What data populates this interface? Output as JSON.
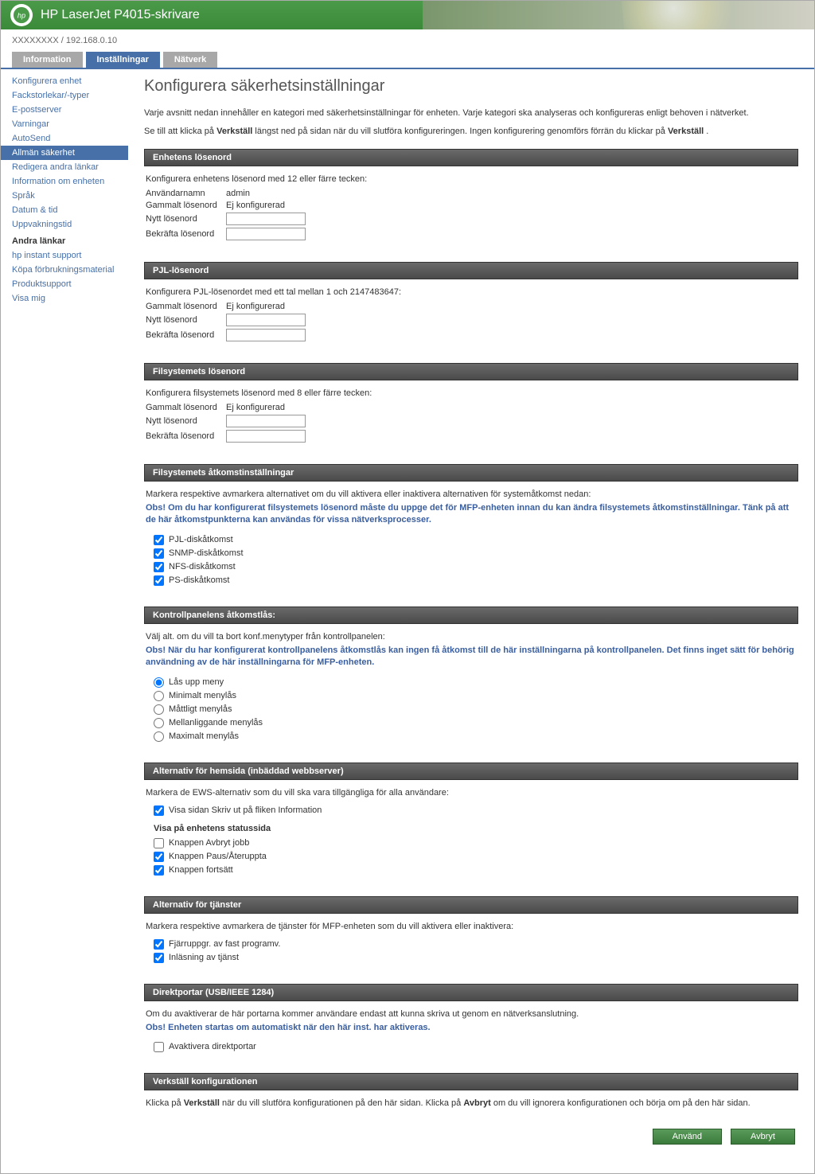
{
  "header": {
    "title": "HP LaserJet P4015-skrivare",
    "subheader": "XXXXXXXX / 192.168.0.10"
  },
  "tabs": {
    "t0": "Information",
    "t1": "Inställningar",
    "t2": "Nätverk"
  },
  "sidebar": {
    "items": [
      "Konfigurera enhet",
      "Fackstorlekar/-typer",
      "E-postserver",
      "Varningar",
      "AutoSend",
      "Allmän säkerhet",
      "Redigera andra länkar",
      "Information om enheten",
      "Språk",
      "Datum & tid",
      "Uppvakningstid"
    ],
    "links_title": "Andra länkar",
    "links": [
      "hp instant support",
      "Köpa förbrukningsmaterial",
      "Produktsupport",
      "Visa mig"
    ]
  },
  "page": {
    "title": "Konfigurera säkerhetsinställningar",
    "intro1": "Varje avsnitt nedan innehåller en kategori med säkerhetsinställningar för enheten. Varje kategori ska analyseras och konfigureras enligt behoven i nätverket.",
    "intro2a": "Se till att klicka på ",
    "intro2b": "Verkställ",
    "intro2c": " längst ned på sidan när du vill slutföra konfigureringen. Ingen konfigurering genomförs förrän du klickar på ",
    "intro2d": "Verkställ",
    "intro2e": " ."
  },
  "sec_device_pw": {
    "title": "Enhetens lösenord",
    "desc": "Konfigurera enhetens lösenord med 12 eller färre tecken:",
    "user_label": "Användarnamn",
    "user_value": "admin",
    "old_label": "Gammalt lösenord",
    "old_value": "Ej konfigurerad",
    "new_label": "Nytt lösenord",
    "confirm_label": "Bekräfta lösenord"
  },
  "sec_pjl": {
    "title": "PJL-lösenord",
    "desc": "Konfigurera PJL-lösenordet med ett tal mellan 1 och 2147483647:",
    "old_label": "Gammalt lösenord",
    "old_value": "Ej konfigurerad",
    "new_label": "Nytt lösenord",
    "confirm_label": "Bekräfta lösenord"
  },
  "sec_fs": {
    "title": "Filsystemets lösenord",
    "desc": "Konfigurera filsystemets lösenord med 8 eller färre tecken:",
    "old_label": "Gammalt lösenord",
    "old_value": "Ej konfigurerad",
    "new_label": "Nytt lösenord",
    "confirm_label": "Bekräfta lösenord"
  },
  "sec_fsaccess": {
    "title": "Filsystemets åtkomstinställningar",
    "desc": "Markera respektive avmarkera alternativet om du vill aktivera eller inaktivera alternativen för systemåtkomst nedan:",
    "note": "Obs! Om du har konfigurerat filsystemets lösenord måste du uppge det för MFP-enheten innan du kan ändra filsystemets åtkomstinställningar. Tänk på att de här åtkomstpunkterna kan användas för vissa nätverksprocesser.",
    "opts": [
      "PJL-diskåtkomst",
      "SNMP-diskåtkomst",
      "NFS-diskåtkomst",
      "PS-diskåtkomst"
    ]
  },
  "sec_cplock": {
    "title": "Kontrollpanelens åtkomstlås:",
    "desc": "Välj alt. om du vill ta bort konf.menytyper från kontrollpanelen:",
    "note": "Obs! När du har konfigurerat kontrollpanelens åtkomstlås kan ingen få åtkomst till de här inställningarna på kontrollpanelen. Det finns inget sätt för behörig användning av de här inställningarna för MFP-enheten.",
    "opts": [
      "Lås upp meny",
      "Minimalt menylås",
      "Måttligt menylås",
      "Mellanliggande menylås",
      "Maximalt menylås"
    ]
  },
  "sec_ews": {
    "title": "Alternativ för hemsida (inbäddad webbserver)",
    "desc": "Markera de EWS-alternativ som du vill ska vara tillgängliga för alla användare:",
    "opt_print": "Visa sidan Skriv ut på fliken Information",
    "status_title": "Visa på enhetens statussida",
    "status_opts": [
      "Knappen Avbryt jobb",
      "Knappen Paus/Återuppta",
      "Knappen fortsätt"
    ]
  },
  "sec_services": {
    "title": "Alternativ för tjänster",
    "desc": "Markera respektive avmarkera de tjänster för MFP-enheten som du vill aktivera eller inaktivera:",
    "opts": [
      "Fjärruppgr. av fast programv.",
      "Inläsning av tjänst"
    ]
  },
  "sec_ports": {
    "title": "Direktportar (USB/IEEE 1284)",
    "desc": "Om du avaktiverar de här portarna kommer användare endast att kunna skriva ut genom en nätverksanslutning.",
    "note": "Obs! Enheten startas om automatiskt när den här inst. har aktiveras.",
    "opt": "Avaktivera direktportar"
  },
  "sec_apply": {
    "title": "Verkställ konfigurationen",
    "desc_a": "Klicka på ",
    "desc_b": "Verkställ",
    "desc_c": " när du vill slutföra konfigurationen på den här sidan. Klicka på ",
    "desc_d": "Avbryt",
    "desc_e": " om du vill ignorera konfigurationen och börja om på den här sidan."
  },
  "buttons": {
    "apply": "Använd",
    "cancel": "Avbryt"
  }
}
